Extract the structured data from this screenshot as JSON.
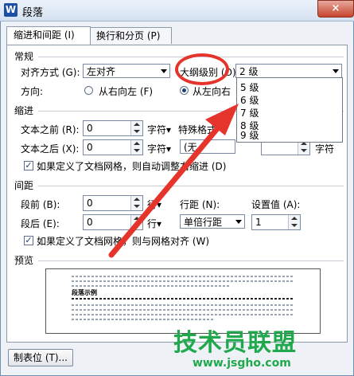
{
  "window": {
    "title": "段落",
    "app_icon": "W",
    "close_glyph": "×"
  },
  "tabs": [
    {
      "label": "缩进和间距 (I)",
      "active": true
    },
    {
      "label": "换行和分页 (P)",
      "active": false
    }
  ],
  "general": {
    "section_label": "常规",
    "alignment_label": "对齐方式 (G):",
    "alignment_value": "左对齐",
    "outline_label": "大纲级别 (O):",
    "outline_value": "2 级",
    "direction_label": "方向:",
    "rtl_label": "从右向左 (F)",
    "ltr_label": "从左向右"
  },
  "outline_dropdown": {
    "items": [
      "5 级",
      "6 级",
      "7 级",
      "8 级",
      "9 级"
    ],
    "right_items": [
      "",
      "",
      "",
      "",
      "",
      "字符"
    ]
  },
  "indent": {
    "section_label": "缩进",
    "before_label": "文本之前 (R):",
    "before_value": "0",
    "before_unit": "字符▾",
    "after_label": "文本之后 (X):",
    "after_value": "0",
    "after_unit": "字符▾",
    "special_label": "特殊格式",
    "special_value": "(无",
    "grid_check_label": "如果定义了文档网格，则自动调整右缩进 (D)"
  },
  "spacing": {
    "section_label": "间距",
    "before_label": "段前 (B):",
    "before_value": "0",
    "before_unit": "行▾",
    "after_label": "段后 (E):",
    "after_value": "0",
    "after_unit": "行▾",
    "line_label": "行距 (N):",
    "line_value": "单倍行距",
    "setting_label": "设置值 (A):",
    "setting_value": "1",
    "grid_check_label": "如果定义了文档网格，则与网格对齐 (W)"
  },
  "preview": {
    "section_label": "预览",
    "sample_text": "段落示例"
  },
  "footer": {
    "tabs_button": "制表位 (T)..."
  },
  "watermark": {
    "text": "技术员联盟",
    "url": "www.jsgho.com"
  },
  "colors": {
    "annotation": "#e5342b",
    "watermark": "#20a84c"
  }
}
